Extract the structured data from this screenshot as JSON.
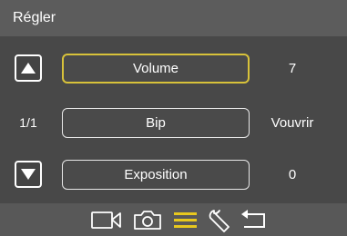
{
  "header": {
    "title": "Régler"
  },
  "pager": {
    "indicator": "1/1"
  },
  "menu": {
    "items": [
      {
        "label": "Volume",
        "value": "7",
        "selected": true
      },
      {
        "label": "Bip",
        "value": "Vouvrir",
        "selected": false
      },
      {
        "label": "Exposition",
        "value": "0",
        "selected": false
      }
    ]
  },
  "tabs": [
    {
      "icon": "video-camera-icon",
      "active": false
    },
    {
      "icon": "photo-camera-icon",
      "active": false
    },
    {
      "icon": "menu-list-icon",
      "active": true
    },
    {
      "icon": "wrench-icon",
      "active": false
    },
    {
      "icon": "back-arrow-icon",
      "active": false
    }
  ],
  "colors": {
    "background": "#4a4a4a",
    "title_bar": "#5c5c5c",
    "bottom_bar": "#585858",
    "accent": "#d8c23a",
    "text": "#ffffff"
  }
}
